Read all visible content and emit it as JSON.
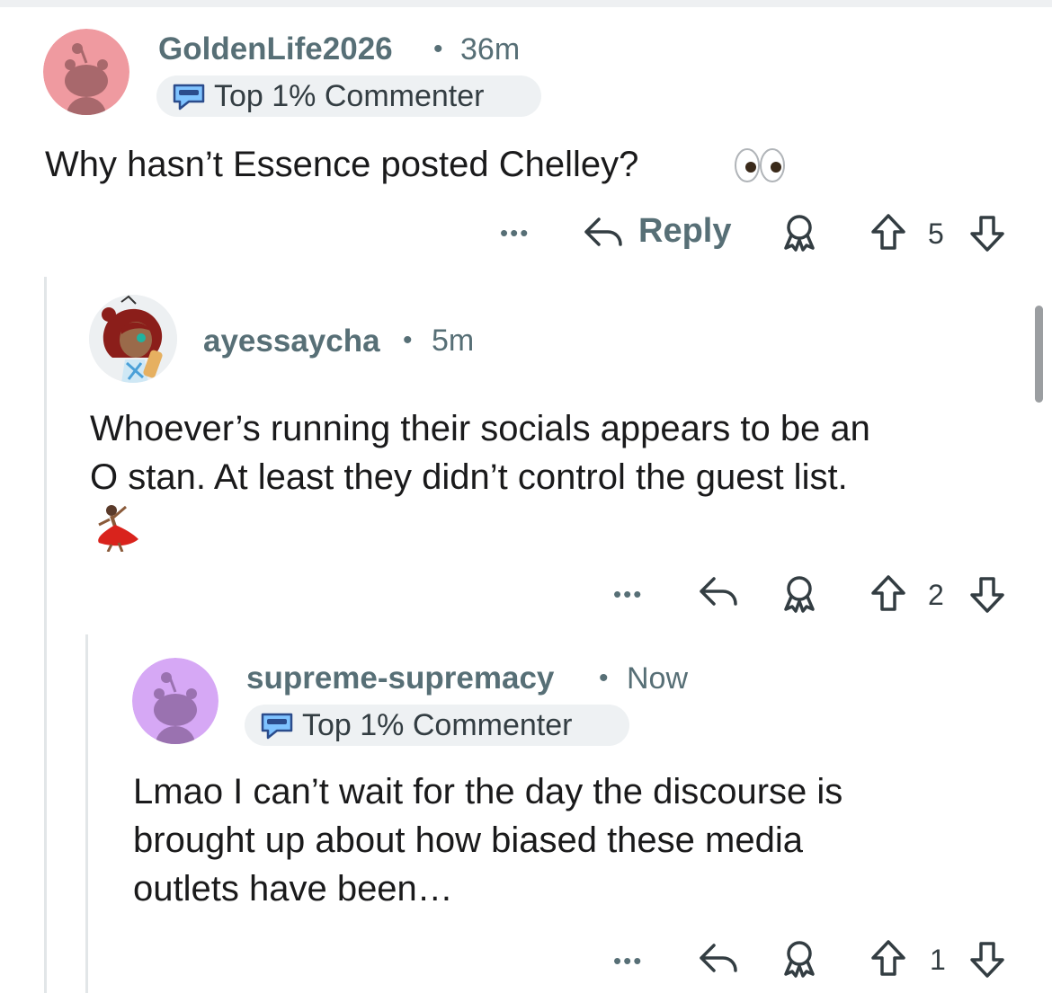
{
  "comments": [
    {
      "username": "GoldenLife2026",
      "separator": "•",
      "time": "36m",
      "badge": "Top 1% Commenter",
      "badge_icon": "commenter-badge-icon",
      "text_lines": [
        "Why hasn’t Essence posted Chelley?"
      ],
      "emoji": "eyes-emoji",
      "reply_label": "Reply",
      "votes": "5",
      "avatar_color": "#ef9aa0"
    },
    {
      "username": "ayessaycha",
      "separator": "•",
      "time": "5m",
      "text_lines": [
        "Whoever’s running their socials appears to be an",
        "O stan. At least they didn’t control the guest list."
      ],
      "emoji": "dancer-emoji",
      "votes": "2"
    },
    {
      "username": "supreme-supremacy",
      "separator": "•",
      "time": "Now",
      "badge": "Top 1% Commenter",
      "badge_icon": "commenter-badge-icon",
      "text_lines": [
        "Lmao I can’t wait for the day the discourse is",
        "brought up about how biased these media",
        "outlets have been…"
      ],
      "votes": "1",
      "avatar_color": "#d6a8f5"
    }
  ],
  "more_label": "•••",
  "colors": {
    "meta": "#576f76",
    "thread_line": "#e2e6e8",
    "badge_bg": "#eef1f3"
  }
}
